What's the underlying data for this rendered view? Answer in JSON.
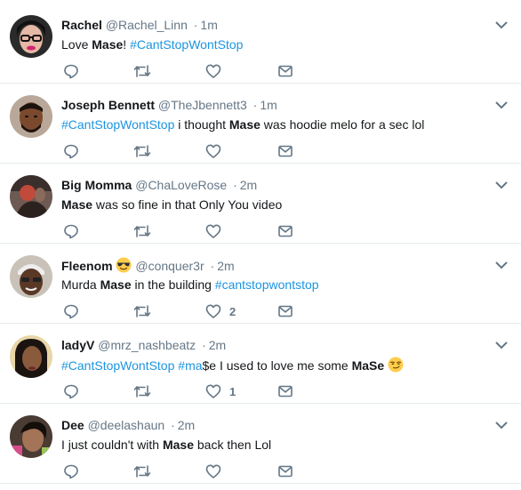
{
  "tweets": [
    {
      "name": "Rachel",
      "handle": "@Rachel_Linn",
      "time": "1m",
      "segments": [
        {
          "t": "Love "
        },
        {
          "t": "Mase",
          "b": true
        },
        {
          "t": "! "
        },
        {
          "t": "#CantStopWontStop",
          "h": true
        }
      ],
      "like_count": ""
    },
    {
      "name": "Joseph Bennett",
      "handle": "@TheJbennett3",
      "time": "1m",
      "segments": [
        {
          "t": "#CantStopWontStop",
          "h": true
        },
        {
          "t": " i thought "
        },
        {
          "t": "Mase",
          "b": true
        },
        {
          "t": " was hoodie melo for a sec lol"
        }
      ],
      "like_count": ""
    },
    {
      "name": "Big Momma",
      "handle": "@ChaLoveRose",
      "time": "2m",
      "segments": [
        {
          "t": "Mase",
          "b": true
        },
        {
          "t": " was so fine in that Only You video"
        }
      ],
      "like_count": ""
    },
    {
      "name": "Fleenom",
      "name_emoji": "sunglasses-face",
      "handle": "@conquer3r",
      "time": "2m",
      "segments": [
        {
          "t": "Murda "
        },
        {
          "t": "Mase",
          "b": true
        },
        {
          "t": " in the building "
        },
        {
          "t": "#cantstopwontstop",
          "h": true
        }
      ],
      "like_count": "2"
    },
    {
      "name": "ladyV",
      "handle": "@mrz_nashbeatz",
      "time": "2m",
      "segments": [
        {
          "t": "#CantStopWontStop",
          "h": true
        },
        {
          "t": " "
        },
        {
          "t": "#ma",
          "h": true
        },
        {
          "t": "$e I used to love me some "
        },
        {
          "t": "MaSe",
          "b": true
        },
        {
          "t": " "
        },
        {
          "e": "smirking-face"
        }
      ],
      "like_count": "1"
    },
    {
      "name": "Dee",
      "handle": "@deelashaun",
      "time": "2m",
      "segments": [
        {
          "t": "I just couldn't with "
        },
        {
          "t": "Mase",
          "b": true
        },
        {
          "t": " back then Lol"
        }
      ],
      "like_count": ""
    }
  ],
  "separator": "·",
  "colors": {
    "accent": "#1b95e0",
    "muted": "#657786",
    "text": "#14171a",
    "border": "#e6ecf0"
  },
  "icons": [
    "reply-icon",
    "retweet-icon",
    "like-icon",
    "direct-message-icon",
    "chevron-down-icon"
  ]
}
